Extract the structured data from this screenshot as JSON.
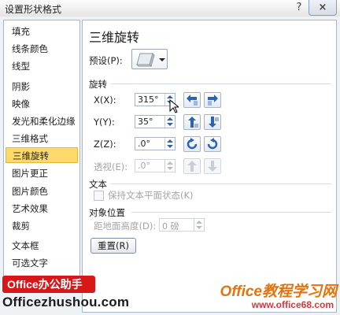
{
  "window": {
    "title": "设置形状格式",
    "help_icon": "?",
    "close_icon": "×"
  },
  "sidebar": {
    "items": [
      {
        "label": "填充"
      },
      {
        "label": "线条颜色"
      },
      {
        "label": "线型"
      },
      {
        "label": "阴影"
      },
      {
        "label": "映像"
      },
      {
        "label": "发光和柔化边缘"
      },
      {
        "label": "三维格式"
      },
      {
        "label": "三维旋转",
        "selected": true
      },
      {
        "label": "图片更正"
      },
      {
        "label": "图片颜色"
      },
      {
        "label": "艺术效果"
      },
      {
        "label": "裁剪"
      },
      {
        "label": "文本框"
      },
      {
        "label": "可选文字"
      }
    ]
  },
  "panel": {
    "heading": "三维旋转",
    "preset": {
      "label": "预设(P):"
    },
    "rotation": {
      "title": "旋转",
      "x": {
        "label": "X(X):",
        "value": "315°"
      },
      "y": {
        "label": "Y(Y):",
        "value": "35°"
      },
      "z": {
        "label": "Z(Z):",
        "value": ".0°"
      },
      "perspective": {
        "label": "透视(E):",
        "value": ".0°",
        "disabled": true
      }
    },
    "text": {
      "title": "文本",
      "keep_flat": {
        "label": "保持文本平面状态(K)",
        "checked": false,
        "disabled": true
      }
    },
    "object_position": {
      "title": "对象位置",
      "distance": {
        "label": "距地面高度(D):",
        "value": "0 磅",
        "disabled": true
      }
    },
    "reset_label": "重置(R)"
  },
  "branding": {
    "badge": "Office办公助手",
    "site": "Officezhushou.com",
    "watermark": "Office教程学习网",
    "watermark_url": "www.office68.com"
  },
  "colors": {
    "selected_bg": "#fbd96a",
    "icon_blue": "#2a63b3",
    "brand_red": "#d71718",
    "watermark_orange": "#e5730e"
  }
}
